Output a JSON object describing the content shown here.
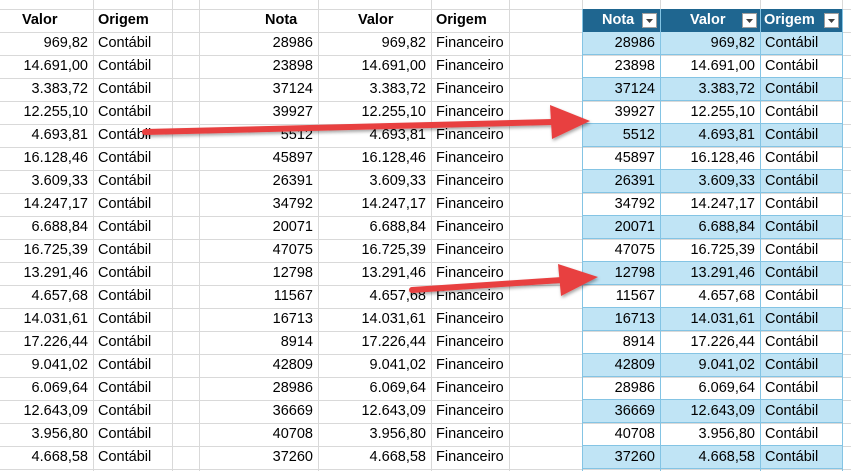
{
  "headers": {
    "left": [
      "Valor",
      "Origem"
    ],
    "middle": [
      "Nota",
      "Valor",
      "Origem"
    ],
    "table": [
      "Nota",
      "Valor",
      "Origem"
    ]
  },
  "left_rows": [
    [
      "969,82",
      "Contábil"
    ],
    [
      "14.691,00",
      "Contábil"
    ],
    [
      "3.383,72",
      "Contábil"
    ],
    [
      "12.255,10",
      "Contábil"
    ],
    [
      "4.693,81",
      "Contábil"
    ],
    [
      "16.128,46",
      "Contábil"
    ],
    [
      "3.609,33",
      "Contábil"
    ],
    [
      "14.247,17",
      "Contábil"
    ],
    [
      "6.688,84",
      "Contábil"
    ],
    [
      "16.725,39",
      "Contábil"
    ],
    [
      "13.291,46",
      "Contábil"
    ],
    [
      "4.657,68",
      "Contábil"
    ],
    [
      "14.031,61",
      "Contábil"
    ],
    [
      "17.226,44",
      "Contábil"
    ],
    [
      "9.041,02",
      "Contábil"
    ],
    [
      "6.069,64",
      "Contábil"
    ],
    [
      "12.643,09",
      "Contábil"
    ],
    [
      "3.956,80",
      "Contábil"
    ],
    [
      "4.668,58",
      "Contábil"
    ]
  ],
  "middle_rows": [
    [
      "28986",
      "969,82",
      "Financeiro"
    ],
    [
      "23898",
      "14.691,00",
      "Financeiro"
    ],
    [
      "37124",
      "3.383,72",
      "Financeiro"
    ],
    [
      "39927",
      "12.255,10",
      "Financeiro"
    ],
    [
      "5512",
      "4.693,81",
      "Financeiro"
    ],
    [
      "45897",
      "16.128,46",
      "Financeiro"
    ],
    [
      "26391",
      "3.609,33",
      "Financeiro"
    ],
    [
      "34792",
      "14.247,17",
      "Financeiro"
    ],
    [
      "20071",
      "6.688,84",
      "Financeiro"
    ],
    [
      "47075",
      "16.725,39",
      "Financeiro"
    ],
    [
      "12798",
      "13.291,46",
      "Financeiro"
    ],
    [
      "11567",
      "4.657,68",
      "Financeiro"
    ],
    [
      "16713",
      "14.031,61",
      "Financeiro"
    ],
    [
      "8914",
      "17.226,44",
      "Financeiro"
    ],
    [
      "42809",
      "9.041,02",
      "Financeiro"
    ],
    [
      "28986",
      "6.069,64",
      "Financeiro"
    ],
    [
      "36669",
      "12.643,09",
      "Financeiro"
    ],
    [
      "40708",
      "3.956,80",
      "Financeiro"
    ],
    [
      "37260",
      "4.668,58",
      "Financeiro"
    ]
  ],
  "table_rows": [
    [
      "28986",
      "969,82",
      "Contábil"
    ],
    [
      "23898",
      "14.691,00",
      "Contábil"
    ],
    [
      "37124",
      "3.383,72",
      "Contábil"
    ],
    [
      "39927",
      "12.255,10",
      "Contábil"
    ],
    [
      "5512",
      "4.693,81",
      "Contábil"
    ],
    [
      "45897",
      "16.128,46",
      "Contábil"
    ],
    [
      "26391",
      "3.609,33",
      "Contábil"
    ],
    [
      "34792",
      "14.247,17",
      "Contábil"
    ],
    [
      "20071",
      "6.688,84",
      "Contábil"
    ],
    [
      "47075",
      "16.725,39",
      "Contábil"
    ],
    [
      "12798",
      "13.291,46",
      "Contábil"
    ],
    [
      "11567",
      "4.657,68",
      "Contábil"
    ],
    [
      "16713",
      "14.031,61",
      "Contábil"
    ],
    [
      "8914",
      "17.226,44",
      "Contábil"
    ],
    [
      "42809",
      "9.041,02",
      "Contábil"
    ],
    [
      "28986",
      "6.069,64",
      "Contábil"
    ],
    [
      "36669",
      "12.643,09",
      "Contábil"
    ],
    [
      "40708",
      "3.956,80",
      "Contábil"
    ],
    [
      "37260",
      "4.668,58",
      "Contábil"
    ]
  ],
  "colors": {
    "table_header": "#1f6690",
    "table_band": "#c0e4f5",
    "arrow": "#e84040",
    "gridline": "#d9d9d9"
  },
  "icons": {
    "filter_dropdown": "dropdown-arrow-icon",
    "annotation": "red-arrow"
  }
}
